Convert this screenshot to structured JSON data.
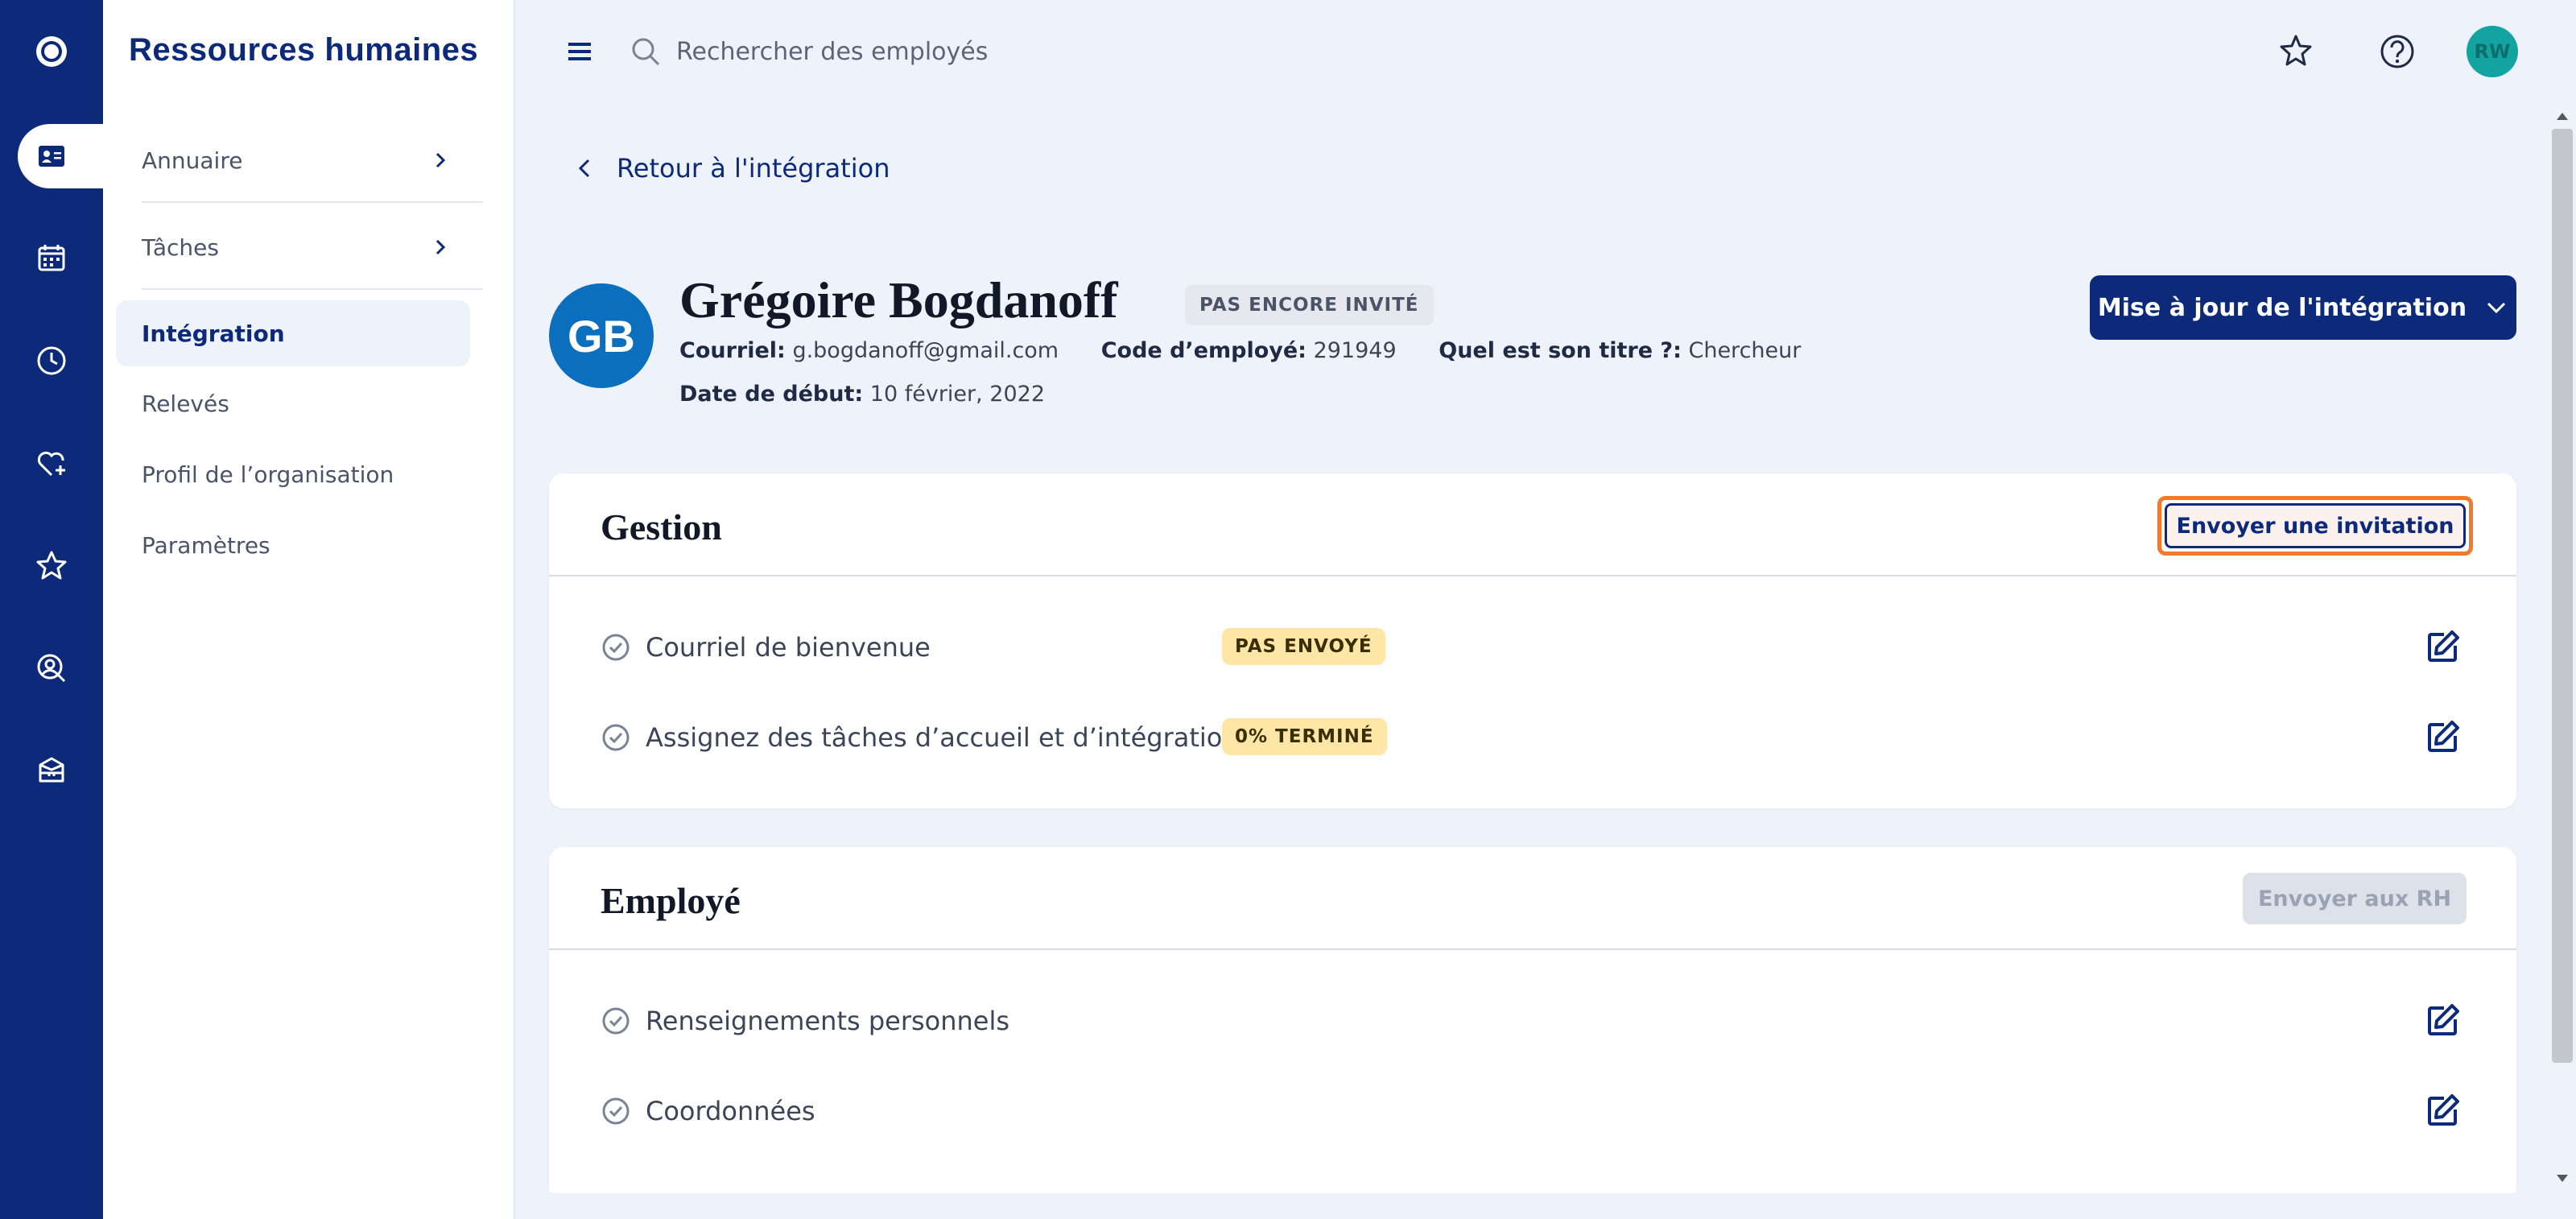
{
  "app": {
    "title": "Ressources humaines",
    "colors": {
      "primary": "#0d2a7a",
      "accent_orange": "#f07b2c",
      "badge_yellow": "#fde6a6",
      "avatar_teal": "#13a3a1",
      "avatar_blue": "#0b6fbd"
    }
  },
  "rail": {
    "items": [
      "logo-icon",
      "employee-card-icon",
      "calendar-icon",
      "clock-icon",
      "heart-plus-icon",
      "star-icon",
      "user-search-icon",
      "box-icon"
    ],
    "active": "employee-card-icon"
  },
  "sidebar": {
    "items": [
      {
        "label": "Annuaire",
        "has_chevron": true
      },
      {
        "label": "Tâches",
        "has_chevron": true
      },
      {
        "label": "Intégration",
        "active": true
      },
      {
        "label": "Relevés"
      },
      {
        "label": "Profil de l’organisation"
      },
      {
        "label": "Paramètres"
      }
    ]
  },
  "topbar": {
    "search_placeholder": "Rechercher des employés",
    "user_initials": "RW"
  },
  "main": {
    "back_label": "Retour à l'intégration",
    "employee": {
      "initials": "GB",
      "name": "Grégoire Bogdanoff",
      "status_badge": "PAS ENCORE INVITÉ",
      "email_label": "Courriel:",
      "email": "g.bogdanoff@gmail.com",
      "code_label": "Code d’employé:",
      "code": "291949",
      "title_label": "Quel est son titre ?:",
      "title": "Chercheur",
      "start_label": "Date de début:",
      "start_date": "10 février, 2022"
    },
    "update_button": "Mise à jour de l'intégration",
    "gestion": {
      "title": "Gestion",
      "action": "Envoyer une invitation",
      "rows": [
        {
          "label": "Courriel de bienvenue",
          "badge": "PAS ENVOYÉ"
        },
        {
          "label": "Assignez des tâches d’accueil et d’intégration",
          "badge": "0% TERMINÉ"
        }
      ]
    },
    "employe": {
      "title": "Employé",
      "action": "Envoyer aux RH",
      "rows": [
        {
          "label": "Renseignements personnels"
        },
        {
          "label": "Coordonnées"
        }
      ]
    }
  }
}
